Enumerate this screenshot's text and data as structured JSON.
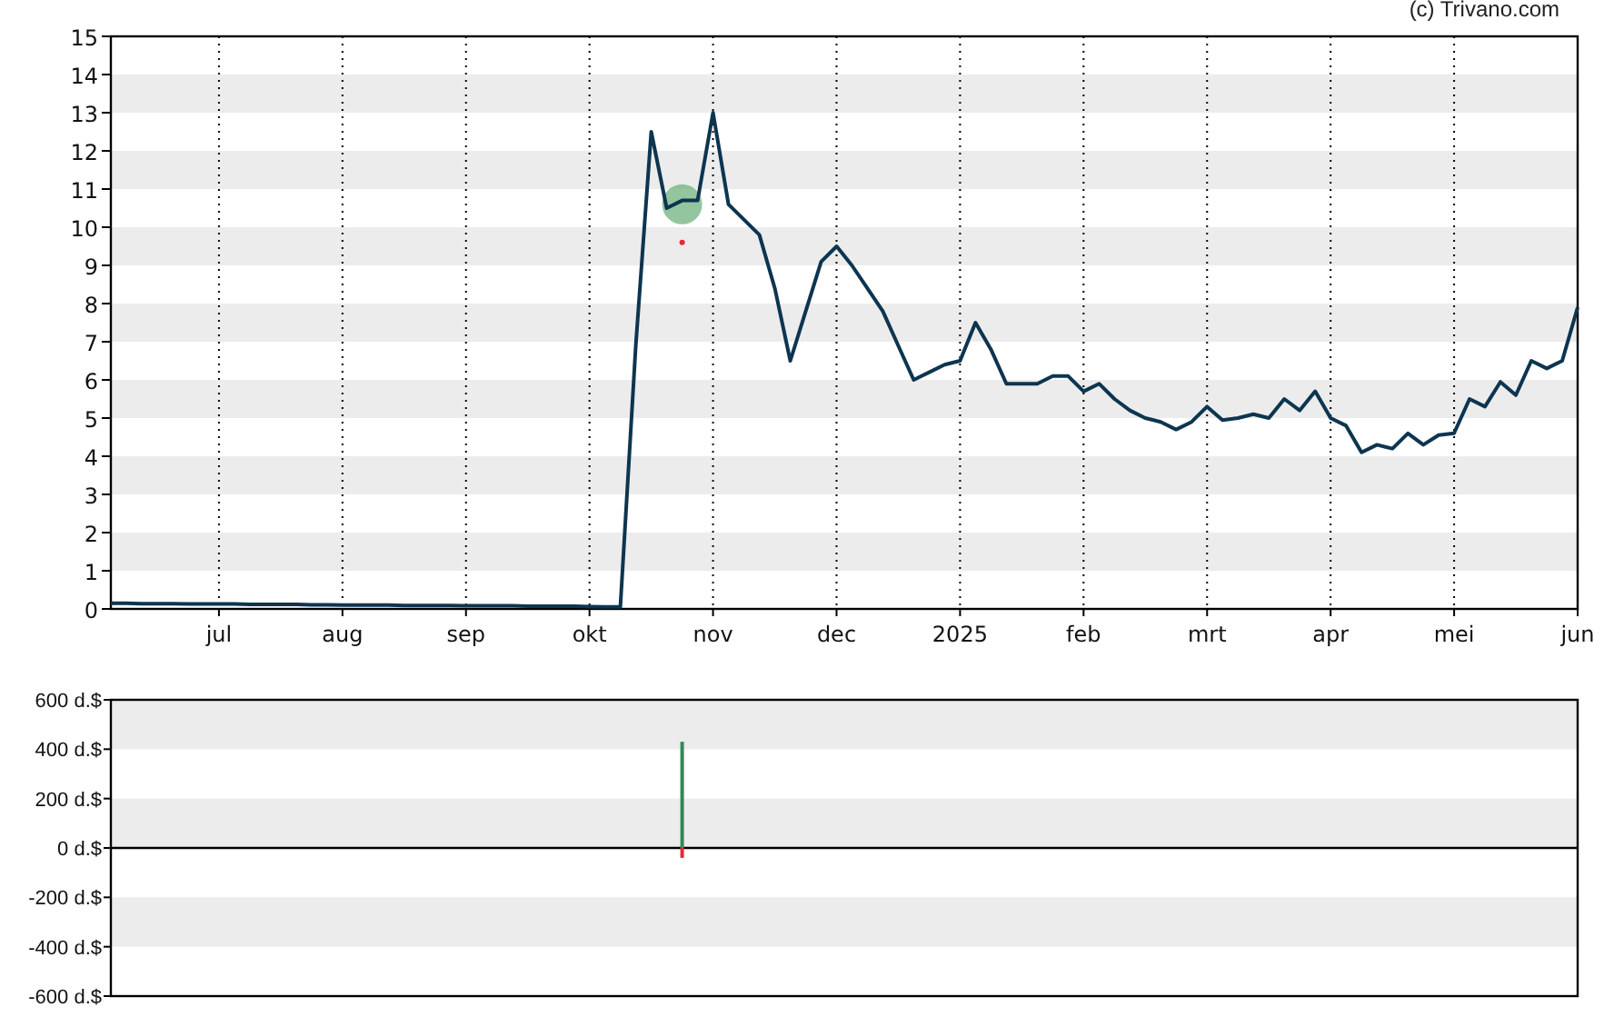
{
  "credit": "(c) Trivano.com",
  "price_chart": {
    "chart_data": {
      "type": "line",
      "categories": [
        null,
        null,
        null,
        null,
        null,
        null,
        null,
        "jul",
        null,
        null,
        null,
        null,
        null,
        null,
        null,
        "aug",
        null,
        null,
        null,
        null,
        null,
        null,
        null,
        "sep",
        null,
        null,
        null,
        null,
        null,
        null,
        null,
        "okt",
        null,
        null,
        null,
        null,
        null,
        null,
        null,
        "nov",
        null,
        null,
        null,
        null,
        null,
        null,
        null,
        "dec",
        null,
        null,
        null,
        null,
        null,
        null,
        null,
        "2025",
        null,
        null,
        null,
        null,
        null,
        null,
        null,
        "feb",
        null,
        null,
        null,
        null,
        null,
        null,
        null,
        "mrt",
        null,
        null,
        null,
        null,
        null,
        null,
        null,
        "apr",
        null,
        null,
        null,
        null,
        null,
        null,
        null,
        "mei",
        null,
        null,
        null,
        null,
        null,
        null,
        null,
        "jun"
      ],
      "series": [
        {
          "color": "#0d3550",
          "values": [
            0.15,
            0.15,
            0.14,
            0.14,
            0.14,
            0.13,
            0.13,
            0.13,
            0.13,
            0.12,
            0.12,
            0.12,
            0.12,
            0.11,
            0.11,
            0.1,
            0.1,
            0.1,
            0.1,
            0.09,
            0.09,
            0.09,
            0.09,
            0.08,
            0.08,
            0.08,
            0.08,
            0.07,
            0.07,
            0.07,
            0.07,
            0.06,
            0.05,
            0.05,
            6.9,
            12.5,
            10.5,
            10.7,
            10.7,
            13,
            10.6,
            10.2,
            9.8,
            8.4,
            6.5,
            7.8,
            9.1,
            9.5,
            9,
            8.4,
            7.8,
            6.9,
            6,
            6.2,
            6.4,
            6.5,
            7.5,
            6.8,
            5.9,
            5.9,
            5.9,
            6.1,
            6.1,
            5.7,
            5.9,
            5.5,
            5.2,
            5,
            4.9,
            4.7,
            4.9,
            5.3,
            4.95,
            5,
            5.1,
            5,
            5.5,
            5.2,
            5.7,
            5,
            4.8,
            4.1,
            4.3,
            4.2,
            4.6,
            4.3,
            4.55,
            4.6,
            5.5,
            5.3,
            5.95,
            5.6,
            6.5,
            6.3,
            6.5,
            7.9
          ]
        }
      ],
      "ylim": [
        0,
        15
      ],
      "yticks": [
        0,
        1,
        2,
        3,
        4,
        5,
        6,
        7,
        8,
        9,
        10,
        11,
        12,
        13,
        14,
        15
      ],
      "grid": true
    }
  },
  "volume_chart": {
    "chart_data": {
      "type": "bar",
      "categories": [
        null,
        null,
        null,
        null,
        null,
        null,
        null,
        null,
        null,
        null,
        null,
        null,
        null,
        null,
        null,
        null,
        null,
        null,
        null,
        null,
        null,
        null,
        null,
        null,
        null,
        null,
        null,
        null,
        null,
        null,
        null,
        null,
        null,
        null,
        null,
        null,
        null,
        null,
        null,
        null,
        null,
        null,
        null,
        null,
        null,
        null,
        null,
        null,
        null,
        null,
        null,
        null,
        null,
        null,
        null,
        null,
        null,
        null,
        null,
        null,
        null,
        null,
        null,
        null,
        null,
        null,
        null,
        null,
        null,
        null,
        null,
        null,
        null,
        null,
        null,
        null,
        null,
        null,
        null,
        null,
        null,
        null,
        null,
        null,
        null,
        null,
        null,
        null,
        null,
        null,
        null,
        null,
        null,
        null,
        null,
        null
      ],
      "series": [
        {
          "color": "#2e8b57",
          "values": [
            null,
            null,
            null,
            null,
            null,
            null,
            null,
            null,
            null,
            null,
            null,
            null,
            null,
            null,
            null,
            null,
            null,
            null,
            null,
            null,
            null,
            null,
            null,
            null,
            null,
            null,
            null,
            null,
            null,
            null,
            null,
            null,
            null,
            null,
            null,
            null,
            null,
            430,
            null,
            null,
            null,
            null,
            null,
            null,
            null,
            null,
            null,
            null,
            null,
            null,
            null,
            null,
            null,
            null,
            null,
            null,
            null,
            null,
            null,
            null,
            null,
            null,
            null,
            null,
            null,
            null,
            null,
            null,
            null,
            null,
            null,
            null,
            null,
            null,
            null,
            null,
            null,
            null,
            null,
            null,
            null,
            null,
            null,
            null,
            null,
            null,
            null,
            null,
            null,
            null,
            null,
            null,
            null,
            null,
            null,
            null
          ]
        },
        {
          "color": "#e8263c",
          "values": [
            null,
            null,
            null,
            null,
            null,
            null,
            null,
            null,
            null,
            null,
            null,
            null,
            null,
            null,
            null,
            null,
            null,
            null,
            null,
            null,
            null,
            null,
            null,
            null,
            null,
            null,
            null,
            null,
            null,
            null,
            null,
            null,
            null,
            null,
            null,
            null,
            null,
            -40,
            null,
            null,
            null,
            null,
            null,
            null,
            null,
            null,
            null,
            null,
            null,
            null,
            null,
            null,
            null,
            null,
            null,
            null,
            null,
            null,
            null,
            null,
            null,
            null,
            null,
            null,
            null,
            null,
            null,
            null,
            null,
            null,
            null,
            null,
            null,
            null,
            null,
            null,
            null,
            null,
            null,
            null,
            null,
            null,
            null,
            null,
            null,
            null,
            null,
            null,
            null,
            null,
            null,
            null,
            null,
            null,
            null,
            null
          ]
        }
      ],
      "ylim": [
        -600,
        600
      ],
      "yticks": [
        {
          "value": 600,
          "label": "600 d.$"
        },
        {
          "value": 400,
          "label": "400 d.$"
        },
        {
          "value": 200,
          "label": "200 d.$"
        },
        {
          "value": 0,
          "label": "0 d.$"
        },
        {
          "value": -200,
          "label": "-200 d.$"
        },
        {
          "value": -400,
          "label": "-400 d.$"
        },
        {
          "value": -600,
          "label": "-600 d.$"
        }
      ]
    }
  }
}
